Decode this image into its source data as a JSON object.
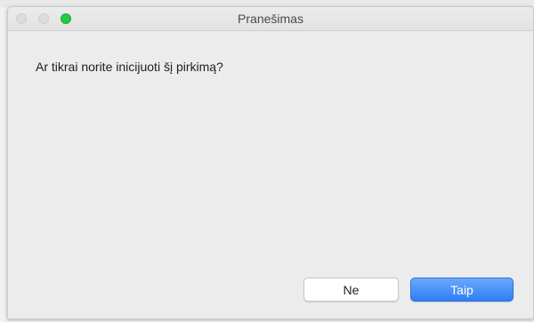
{
  "window": {
    "title": "Pranešimas"
  },
  "dialog": {
    "message": "Ar tikrai norite inicijuoti šį pirkimą?",
    "no_label": "Ne",
    "yes_label": "Taip"
  },
  "colors": {
    "zoom": "#27c93f",
    "primary_button": "#3a86f7"
  },
  "icons": [
    "close-icon",
    "minimize-icon",
    "zoom-icon"
  ]
}
